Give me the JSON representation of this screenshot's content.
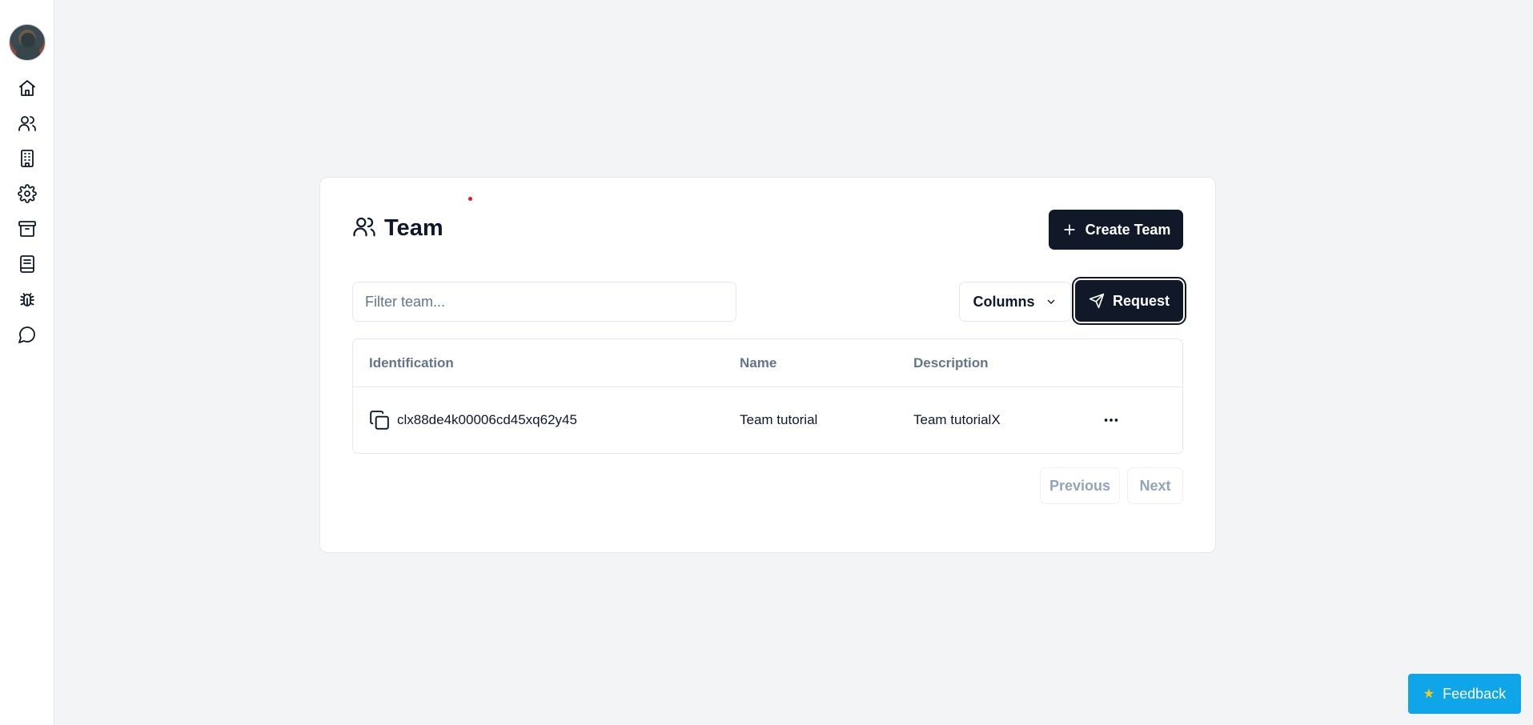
{
  "sidebar": {
    "avatar_alt": "User avatar",
    "items": [
      {
        "icon": "home-icon"
      },
      {
        "icon": "users-icon"
      },
      {
        "icon": "building-icon"
      },
      {
        "icon": "gear-icon"
      },
      {
        "icon": "archive-icon"
      },
      {
        "icon": "book-icon"
      },
      {
        "icon": "bug-icon"
      },
      {
        "icon": "message-circle-icon"
      }
    ]
  },
  "header": {
    "title": "Team",
    "title_icon": "users-icon",
    "create_button_label": "Create Team"
  },
  "toolbar": {
    "filter_placeholder": "Filter team...",
    "filter_value": "",
    "columns_label": "Columns",
    "request_label": "Request"
  },
  "table": {
    "columns": [
      "Identification",
      "Name",
      "Description"
    ],
    "rows": [
      {
        "identification": "clx88de4k00006cd45xq62y45",
        "name": "Team tutorial",
        "description": "Team tutorialX"
      }
    ]
  },
  "pagination": {
    "previous_label": "Previous",
    "next_label": "Next"
  },
  "feedback": {
    "label": "Feedback"
  },
  "colors": {
    "background": "#f3f4f6",
    "primary_dark": "#111827",
    "feedback_blue": "#0ea5e9",
    "muted_text": "#64748b"
  }
}
